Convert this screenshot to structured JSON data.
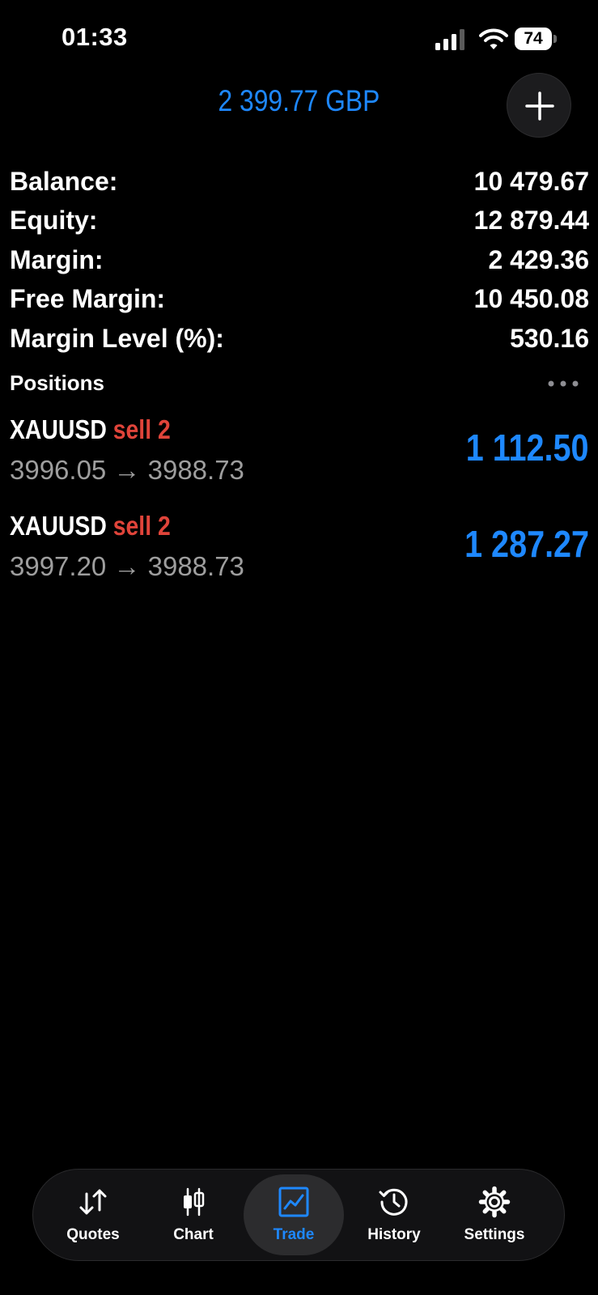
{
  "status_bar": {
    "time": "01:33",
    "battery": "74"
  },
  "header": {
    "equity_display": "2 399.77 GBP"
  },
  "summary": [
    {
      "label": "Balance:",
      "value": "10 479.67"
    },
    {
      "label": "Equity:",
      "value": "12 879.44"
    },
    {
      "label": "Margin:",
      "value": "2 429.36"
    },
    {
      "label": "Free Margin:",
      "value": "10 450.08"
    },
    {
      "label": "Margin Level (%):",
      "value": "530.16"
    }
  ],
  "positions": {
    "title": "Positions",
    "items": [
      {
        "symbol": "XAUUSD",
        "type": "sell 2",
        "prices": "3996.05 → 3988.73",
        "profit": "1 112.50"
      },
      {
        "symbol": "XAUUSD",
        "type": "sell 2",
        "prices": "3997.20 → 3988.73",
        "profit": "1 287.27"
      }
    ]
  },
  "tabs": [
    {
      "label": "Quotes",
      "icon": "quotes-arrows-icon"
    },
    {
      "label": "Chart",
      "icon": "candlestick-chart-icon"
    },
    {
      "label": "Trade",
      "icon": "trade-chart-icon",
      "active": true
    },
    {
      "label": "History",
      "icon": "history-clock-icon"
    },
    {
      "label": "Settings",
      "icon": "gear-icon"
    }
  ],
  "colors": {
    "accent": "#1e88ff",
    "sell": "#e0443a",
    "background": "#000000"
  }
}
